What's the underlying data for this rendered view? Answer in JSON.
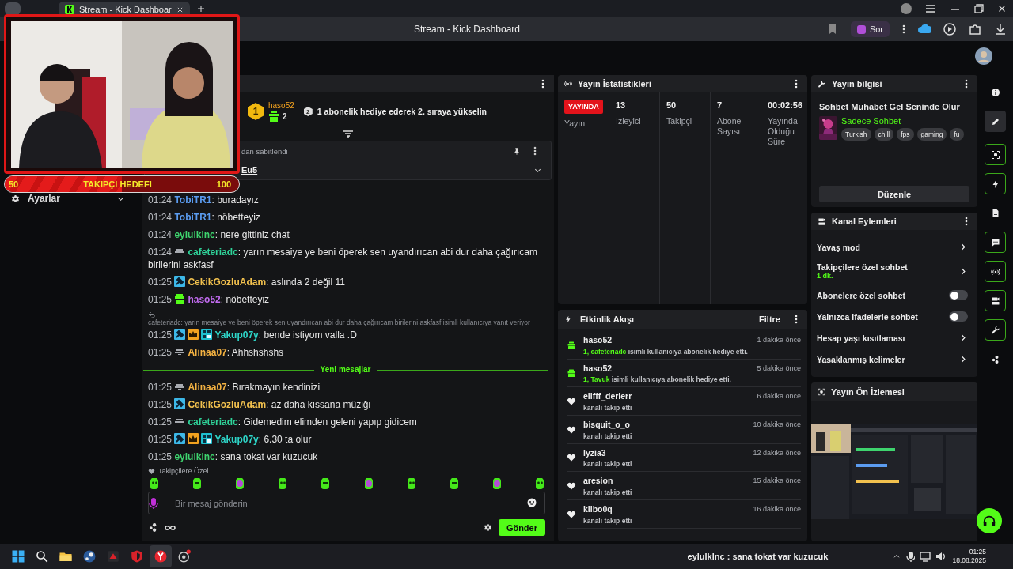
{
  "browser": {
    "tab_title": "Stream - Kick Dashboar",
    "page_title": "Stream - Kick Dashboard",
    "ask_button": "Sor"
  },
  "sidebar": {
    "settings_label": "Ayarlar",
    "expanded": false
  },
  "webcam": {
    "kind": "picture",
    "goal": {
      "start": "50",
      "label": "TAKIPÇI HEDEFI",
      "target": "100",
      "level": 0.5
    }
  },
  "chat": {
    "leader": {
      "rank": "1",
      "user": "haso52",
      "gifts": "2",
      "next_rank": "2",
      "hint": "1 abonelik hediye ederek 2. sıraya yükselin"
    },
    "pinned": {
      "label": "dan sabitlendi",
      "text": "Eu5",
      "expanded": false
    },
    "messages": [
      {
        "kind": "message",
        "time": "01:24",
        "user": "TobiTR1",
        "color": "#5b9cf0",
        "text": ": buradayız"
      },
      {
        "kind": "message",
        "time": "01:24",
        "user": "TobiTR1",
        "color": "#5b9cf0",
        "text": ": nöbetteyiz"
      },
      {
        "kind": "message",
        "time": "01:24",
        "user": "eylulklnc",
        "color": "#3ed46e",
        "text": ": nere gittiniz chat"
      },
      {
        "kind": "message",
        "time": "01:24",
        "badges": [
          {
            "kind": "subscriber"
          }
        ],
        "user": "cafeteriadc",
        "color": "#2fd49a",
        "text": ": yarın mesaiye ye beni öperek sen uyandırıcan abi dur daha çağırıcam birilerini askfasf"
      },
      {
        "kind": "message",
        "time": "01:25",
        "badges": [
          {
            "kind": "moderator"
          }
        ],
        "user": "CekikGozluAdam",
        "color": "#f2c14e",
        "text": ": aslında 2 değil 11"
      },
      {
        "kind": "message",
        "time": "01:25",
        "badges": [
          {
            "kind": "gift"
          }
        ],
        "user": "haso52",
        "color": "#c26cf0",
        "text": ": nöbetteyiz"
      },
      {
        "kind": "message",
        "time": "01:25",
        "badges": [
          {
            "kind": "moderator"
          },
          {
            "kind": "vip"
          },
          {
            "kind": "og"
          }
        ],
        "user": "Yakup07y",
        "color": "#2ed6c9",
        "text": ": bende istiyom valla .D",
        "reply": "cafeteriadc: yarın mesaiye ye beni öperek sen uyandırıcan abi dur daha çağırıcam birilerini askfasf isimli kullanıcıya yanıt veriyor"
      },
      {
        "kind": "message",
        "time": "01:25",
        "badges": [
          {
            "kind": "subscriber"
          }
        ],
        "user": "Alinaa07",
        "color": "#f5b342",
        "text": ": Ahhshshshs"
      },
      {
        "kind": "divider",
        "text": "Yeni mesajlar"
      },
      {
        "kind": "message",
        "time": "01:25",
        "badges": [
          {
            "kind": "subscriber"
          }
        ],
        "user": "Alinaa07",
        "color": "#f5b342",
        "text": ": Bırakmayın kendinizi"
      },
      {
        "kind": "message",
        "time": "01:25",
        "badges": [
          {
            "kind": "moderator"
          }
        ],
        "user": "CekikGozluAdam",
        "color": "#f2c14e",
        "text": ": az daha kıssana müziği"
      },
      {
        "kind": "message",
        "time": "01:25",
        "badges": [
          {
            "kind": "subscriber"
          }
        ],
        "user": "cafeteriadc",
        "color": "#2fd49a",
        "text": ": Gidemedim elimden geleni yapıp gidicem"
      },
      {
        "kind": "message",
        "time": "01:25",
        "badges": [
          {
            "kind": "moderator"
          },
          {
            "kind": "vip"
          },
          {
            "kind": "og"
          }
        ],
        "user": "Yakup07y",
        "color": "#2ed6c9",
        "text": ": 6.30 ta olur"
      },
      {
        "kind": "message",
        "time": "01:25",
        "user": "eylulklnc",
        "color": "#3ed46e",
        "text": ": sana tokat var kuzucuk"
      }
    ],
    "followers_only": "Takipçilere Özel",
    "input": {
      "placeholder": "Bir mesaj gönderin"
    },
    "send_button": "Gönder"
  },
  "stats": {
    "title": "Yayın İstatistikleri",
    "columns": [
      {
        "kind": "badge",
        "value": "YAYINDA",
        "label": "Yayın"
      },
      {
        "kind": "number",
        "value": "13",
        "label": "İzleyici"
      },
      {
        "kind": "number",
        "value": "50",
        "label": "Takipçi"
      },
      {
        "kind": "number",
        "value": "7",
        "label": "Abone Sayısı"
      },
      {
        "kind": "number",
        "value": "00:02:56",
        "label": "Yayında Olduğu Süre"
      }
    ]
  },
  "activity": {
    "title": "Etkinlik Akışı",
    "filter": "Filtre",
    "items": [
      {
        "kind": "gift",
        "user": "haso52",
        "time": "1 dakika önce",
        "detail": "**1, cafeteriadc** isimli kullanıcıya abonelik hediye etti."
      },
      {
        "kind": "gift",
        "user": "haso52",
        "time": "5 dakika önce",
        "detail": "**1, Tavuk** isimli kullanıcıya abonelik hediye etti."
      },
      {
        "kind": "follow",
        "user": "elifff_derlerr",
        "time": "6 dakika önce",
        "detail": "kanalı takip etti"
      },
      {
        "kind": "follow",
        "user": "bisquit_o_o",
        "time": "10 dakika önce",
        "detail": "kanalı takip etti"
      },
      {
        "kind": "follow",
        "user": "lyzia3",
        "time": "12 dakika önce",
        "detail": "kanalı takip etti"
      },
      {
        "kind": "follow",
        "user": "aresion",
        "time": "15 dakika önce",
        "detail": "kanalı takip etti"
      },
      {
        "kind": "follow",
        "user": "klibo0q",
        "time": "16 dakika önce",
        "detail": "kanalı takip etti"
      }
    ]
  },
  "stream_info": {
    "title": "Yayın bilgisi",
    "stream_title": "Sohbet Muhabet Gel Seninde Olur",
    "category": "Sadece Sohbet",
    "tags": [
      "Turkish",
      "chill",
      "fps",
      "gaming",
      "fu"
    ],
    "edit_button": "Düzenle"
  },
  "channel_actions": {
    "title": "Kanal Eylemleri",
    "items": [
      {
        "kind": "link",
        "label": "Yavaş mod"
      },
      {
        "kind": "link",
        "label": "Takipçilere özel sohbet",
        "value": "1 dk."
      },
      {
        "kind": "toggle",
        "label": "Abonelere özel sohbet",
        "on": false
      },
      {
        "kind": "toggle",
        "label": "Yalnızca ifadelerle sohbet",
        "on": false
      },
      {
        "kind": "link",
        "label": "Hesap yaşı kısıtlaması"
      },
      {
        "kind": "link",
        "label": "Yasaklanmış kelimeler"
      }
    ]
  },
  "preview": {
    "title": "Yayın Ön İzlemesi",
    "kind": "picture"
  },
  "rail": [
    {
      "kind": "info",
      "selected": false,
      "active": false
    },
    {
      "kind": "edit",
      "selected": true,
      "active": false
    },
    {
      "kind": "capture",
      "selected": false,
      "active": true
    },
    {
      "kind": "bolt",
      "selected": false,
      "active": true
    },
    {
      "kind": "doc",
      "selected": false,
      "active": false
    },
    {
      "kind": "chat",
      "selected": false,
      "active": true
    },
    {
      "kind": "broadcast",
      "selected": false,
      "active": true
    },
    {
      "kind": "camera",
      "selected": false,
      "active": true
    },
    {
      "kind": "wrench",
      "selected": false,
      "active": true
    },
    {
      "kind": "dots",
      "selected": false,
      "active": false
    }
  ],
  "taskbar": {
    "apps": [
      {
        "kind": "start",
        "selected": false
      },
      {
        "kind": "search",
        "selected": false
      },
      {
        "kind": "folder",
        "selected": false
      },
      {
        "kind": "steam",
        "selected": false
      },
      {
        "kind": "game",
        "selected": false
      },
      {
        "kind": "shield",
        "selected": false
      },
      {
        "kind": "browser",
        "selected": true
      },
      {
        "kind": "app",
        "selected": false
      }
    ],
    "notification": "eylulklnc : sana tokat var kuzucuk",
    "time": "01:25",
    "date": "18.08.2025"
  }
}
